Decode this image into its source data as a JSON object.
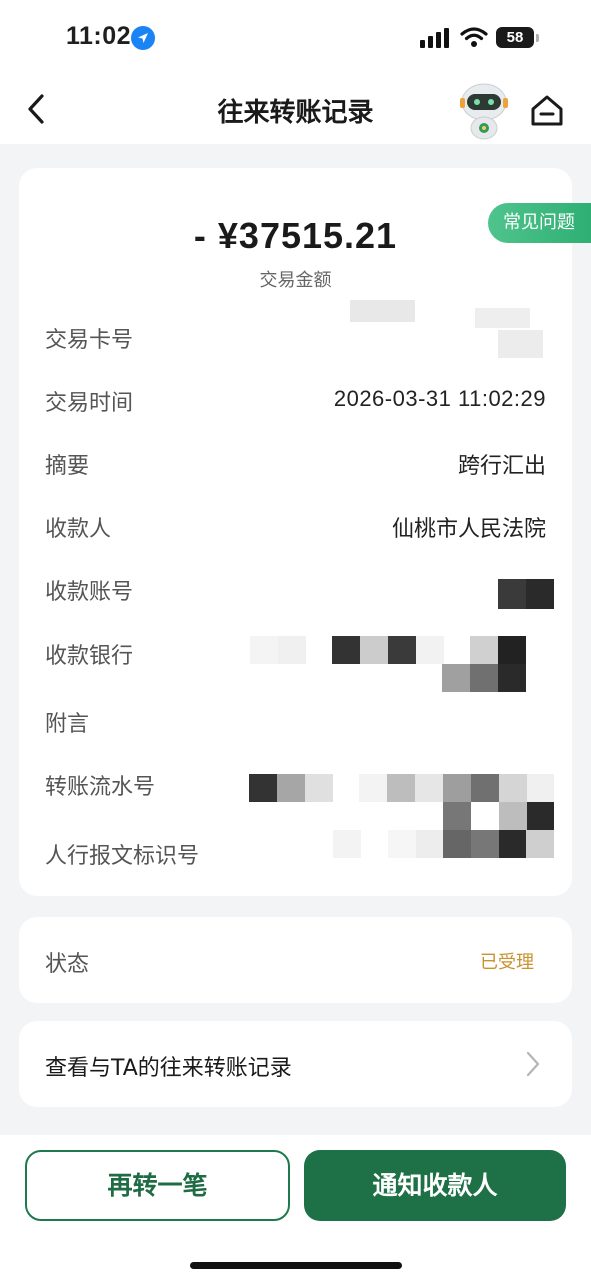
{
  "status_bar": {
    "time": "11:02",
    "battery": "58"
  },
  "nav": {
    "title": "往来转账记录"
  },
  "faq_tag": "常见问题",
  "amount": {
    "value": "- ¥37515.21",
    "label": "交易金额"
  },
  "details": {
    "rows": [
      {
        "label": "交易卡号",
        "value": ""
      },
      {
        "label": "交易时间",
        "value": "2026-03-31 11:02:29"
      },
      {
        "label": "摘要",
        "value": "跨行汇出"
      },
      {
        "label": "收款人",
        "value": "仙桃市人民法院"
      },
      {
        "label": "收款账号",
        "value": ""
      },
      {
        "label": "收款银行",
        "value": ""
      },
      {
        "label": "附言",
        "value": ""
      },
      {
        "label": "转账流水号",
        "value": ""
      },
      {
        "label": "人行报文标识号",
        "value": ""
      }
    ]
  },
  "status": {
    "label": "状态",
    "value": "已受理"
  },
  "history": {
    "label": "查看与TA的往来转账记录"
  },
  "buttons": {
    "again": "再转一笔",
    "notify": "通知收款人"
  },
  "colors": {
    "brand_green": "#1e7046",
    "faq_green": "#3dbb80",
    "status_orange": "#c9922e"
  }
}
